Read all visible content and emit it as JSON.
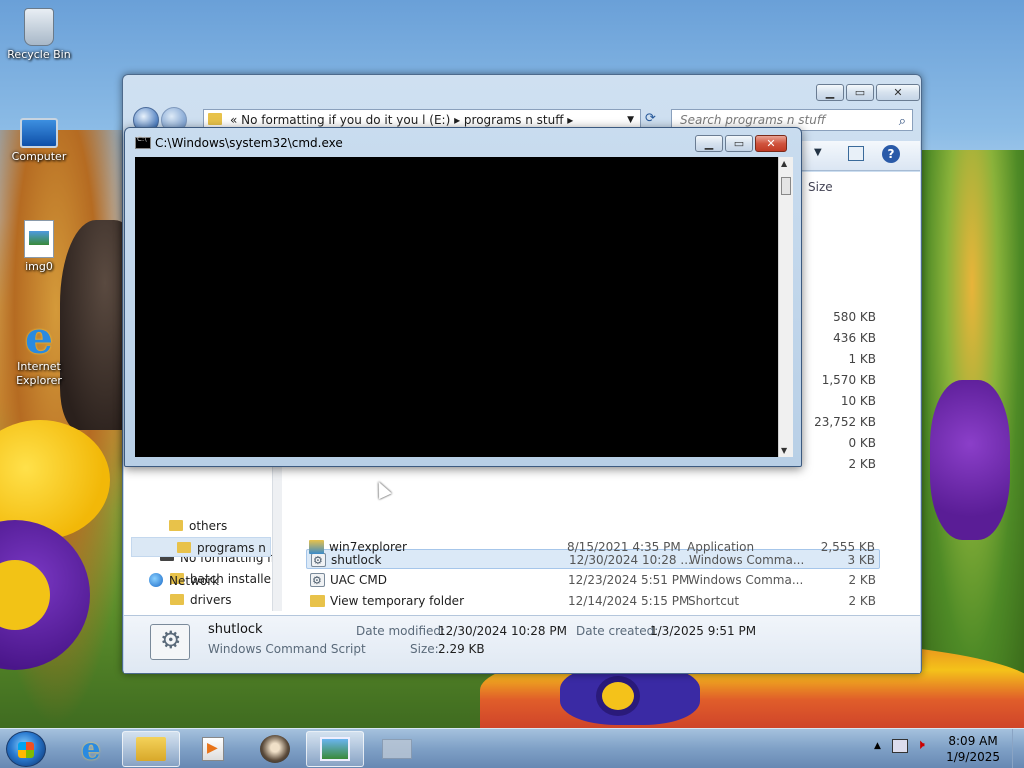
{
  "desktop": {
    "icons": [
      {
        "label": "Recycle Bin"
      },
      {
        "label": "Computer"
      },
      {
        "label": "img0"
      },
      {
        "label": "Internet Explorer"
      }
    ]
  },
  "explorer": {
    "address": "«  No formatting if you do it you l (E:)  ▸  programs n stuff  ▸",
    "search_placeholder": "Search programs n stuff",
    "size_header": "Size",
    "upper_sizes": [
      "580 KB",
      "436 KB",
      "1 KB",
      "1,570 KB",
      "10 KB",
      "23,752 KB",
      "0 KB",
      "2 KB"
    ],
    "nav": {
      "drive": "No formatting if",
      "folders": [
        "batch installers",
        "drivers",
        "others",
        "programs n stu"
      ],
      "network": "Network"
    },
    "files": [
      {
        "name": "shutlock",
        "date": "12/30/2024 10:28 ...",
        "type": "Windows Comma...",
        "size": "3 KB"
      },
      {
        "name": "UAC CMD",
        "date": "12/23/2024 5:51 PM",
        "type": "Windows Comma...",
        "size": "2 KB"
      },
      {
        "name": "View temporary folder",
        "date": "12/14/2024 5:15 PM",
        "type": "Shortcut",
        "size": "2 KB"
      },
      {
        "name": "win7explorer",
        "date": "8/15/2021 4:35 PM",
        "type": "Application",
        "size": "2,555 KB"
      }
    ],
    "details": {
      "name": "shutlock",
      "type": "Windows Command Script",
      "modified_label": "Date modified:",
      "modified_value": "12/30/2024 10:28 PM",
      "created_label": "Date created:",
      "created_value": "1/3/2025 9:51 PM",
      "size_label": "Size:",
      "size_value": "2.29 KB"
    }
  },
  "cmd": {
    "title": "C:\\Windows\\system32\\cmd.exe"
  },
  "taskbar": {
    "time": "8:09 AM",
    "date": "1/9/2025"
  },
  "colors": {
    "selection": "#dbe9f7",
    "console_bg": "#000000",
    "taskbar": "#7f9bc4"
  }
}
